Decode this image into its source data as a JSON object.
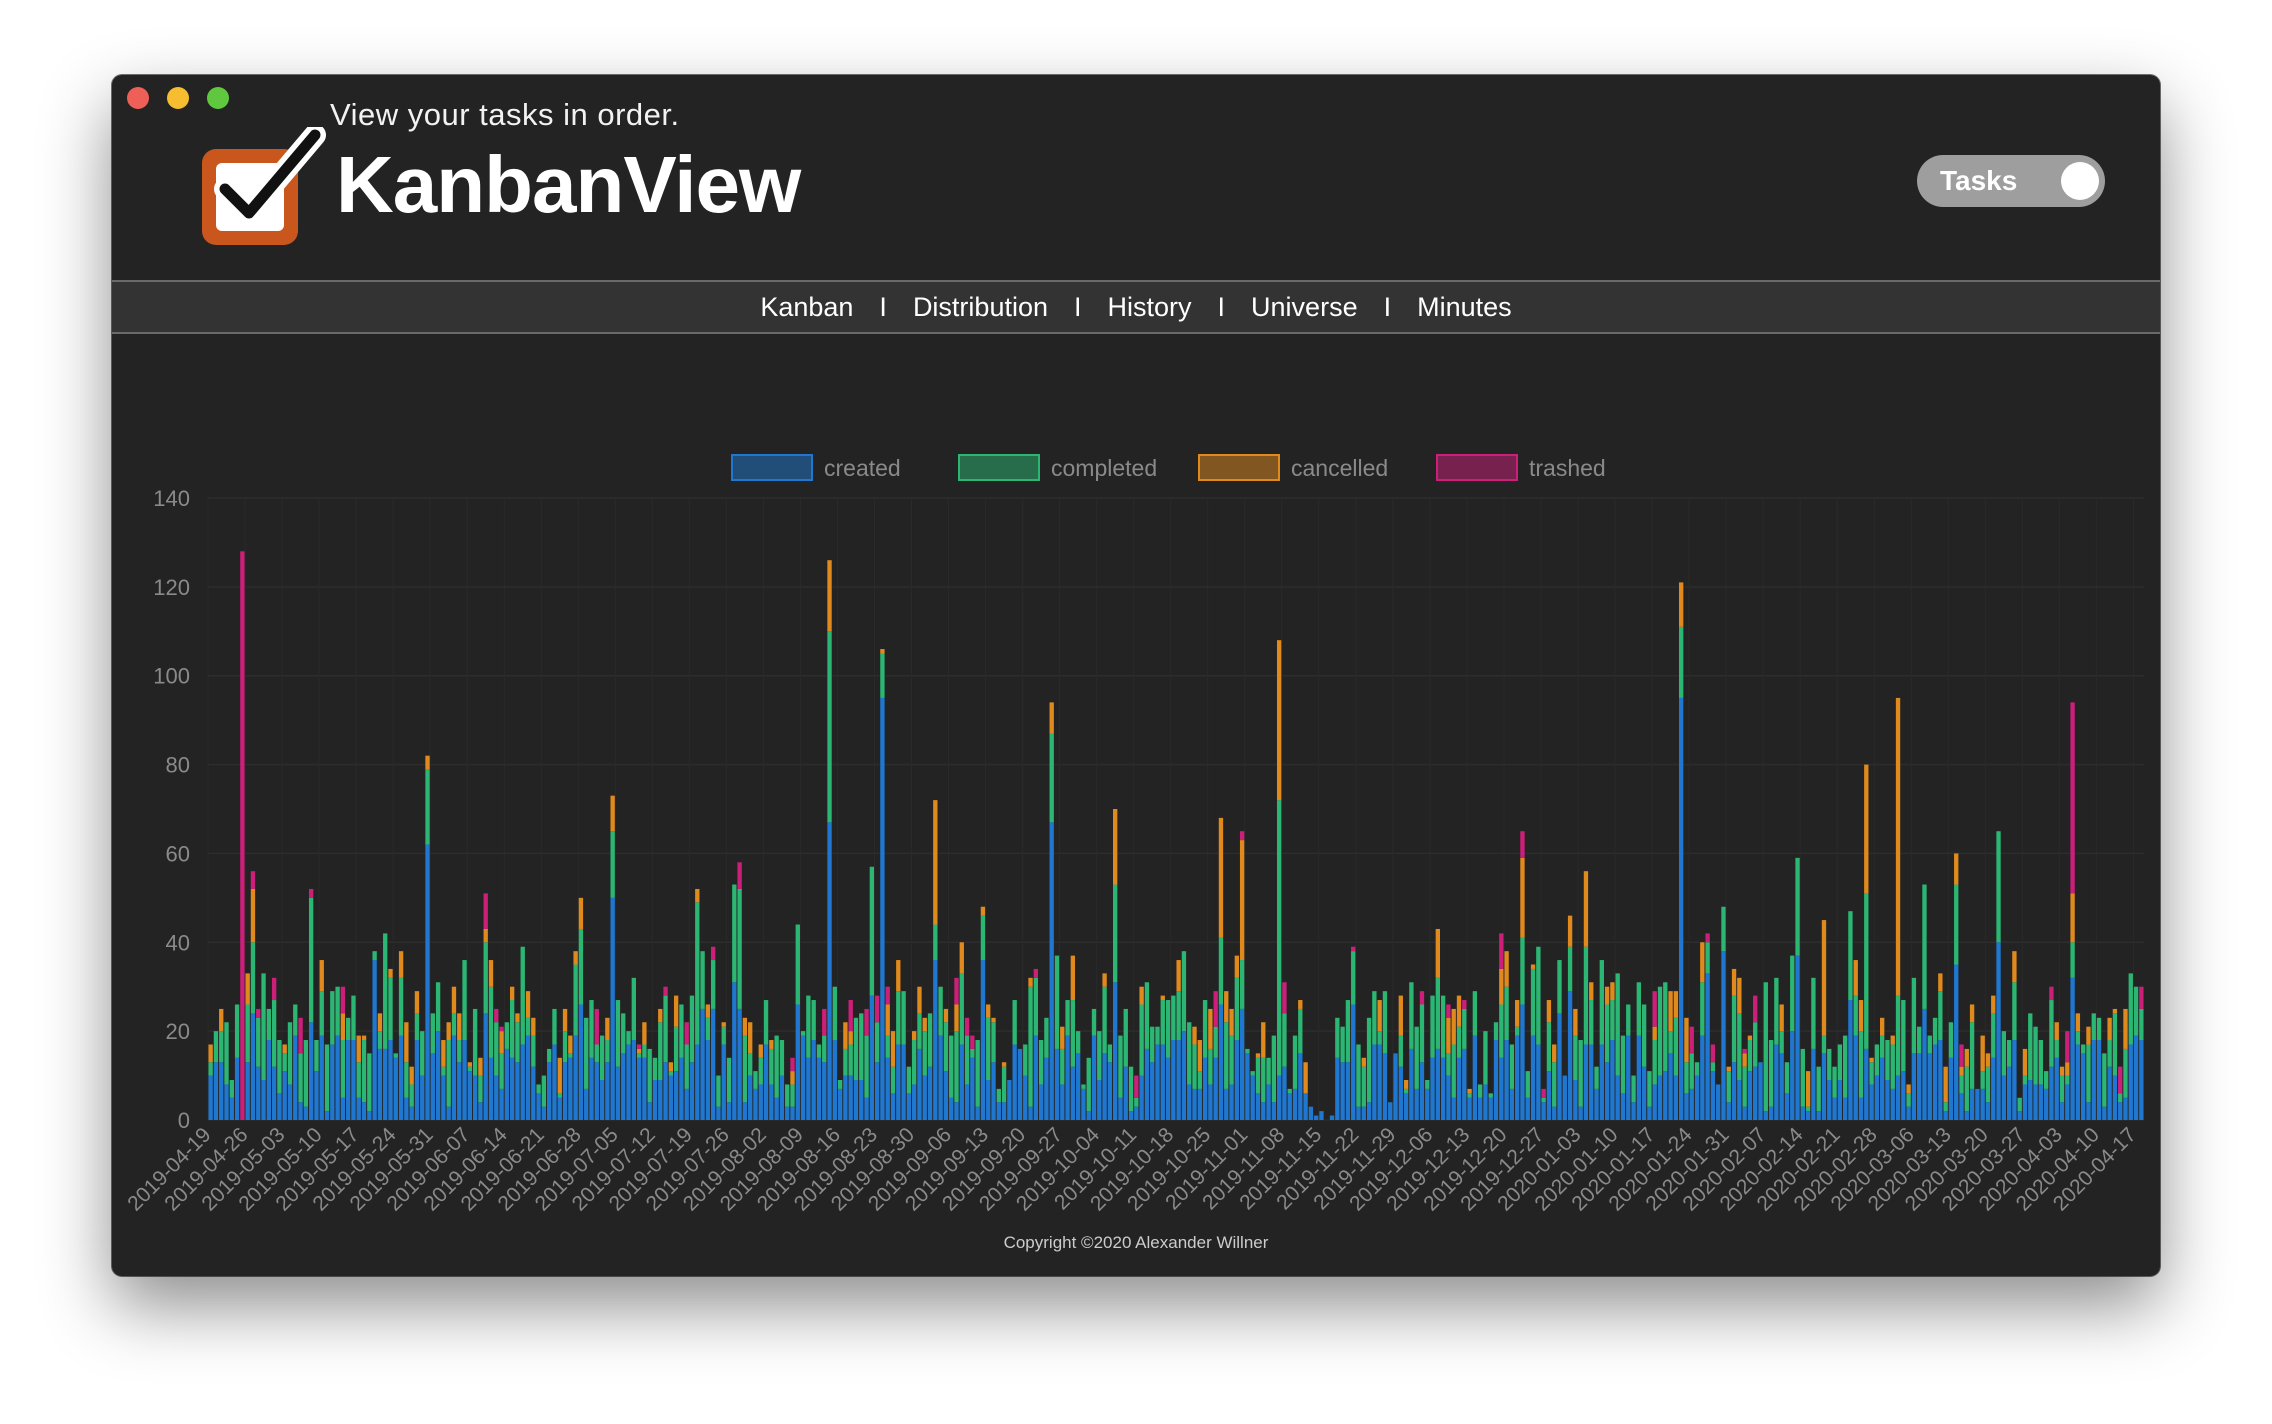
{
  "app": {
    "tagline": "View your tasks in order.",
    "brand": "KanbanView",
    "toggle_label": "Tasks",
    "footer": "Copyright ©2020 Alexander Willner"
  },
  "nav": {
    "items": [
      "Kanban",
      "Distribution",
      "History",
      "Universe",
      "Minutes"
    ],
    "separator": "I"
  },
  "colors": {
    "created": "#1f77d0",
    "completed": "#2bb673",
    "cancelled": "#e08a1e",
    "trashed": "#cc1f7a",
    "background": "#232323"
  },
  "chart_data": {
    "type": "bar",
    "stacked": true,
    "ylim": [
      0,
      140
    ],
    "yticks": [
      0,
      20,
      40,
      60,
      80,
      100,
      120,
      140
    ],
    "grid": true,
    "legend_position": "top-center",
    "legend": [
      "created",
      "completed",
      "cancelled",
      "trashed"
    ],
    "x_start": "2019-04-19",
    "x_end": "2020-04-19",
    "xticks": [
      "2019-04-19",
      "2019-04-26",
      "2019-05-03",
      "2019-05-10",
      "2019-05-17",
      "2019-05-24",
      "2019-05-31",
      "2019-06-07",
      "2019-06-14",
      "2019-06-21",
      "2019-06-28",
      "2019-07-05",
      "2019-07-12",
      "2019-07-19",
      "2019-07-26",
      "2019-08-02",
      "2019-08-09",
      "2019-08-16",
      "2019-08-23",
      "2019-08-30",
      "2019-09-06",
      "2019-09-13",
      "2019-09-20",
      "2019-09-27",
      "2019-10-04",
      "2019-10-11",
      "2019-10-18",
      "2019-10-25",
      "2019-11-01",
      "2019-11-08",
      "2019-11-15",
      "2019-11-22",
      "2019-11-29",
      "2019-12-06",
      "2019-12-13",
      "2019-12-20",
      "2019-12-27",
      "2020-01-03",
      "2020-01-10",
      "2020-01-17",
      "2020-01-24",
      "2020-01-31",
      "2020-02-07",
      "2020-02-14",
      "2020-02-21",
      "2020-02-28",
      "2020-03-06",
      "2020-03-13",
      "2020-03-20",
      "2020-03-27",
      "2020-04-03",
      "2020-04-10",
      "2020-04-17"
    ],
    "peaks": [
      {
        "date": "2019-04-25",
        "trashed": 128
      },
      {
        "date": "2019-08-14",
        "created": 67,
        "completed": 43,
        "cancelled": 16
      },
      {
        "date": "2019-08-24",
        "created": 95,
        "completed": 10,
        "cancelled": 1
      },
      {
        "date": "2019-09-25",
        "created": 67,
        "completed": 20,
        "cancelled": 7
      },
      {
        "date": "2019-11-07",
        "created": 10,
        "completed": 62,
        "cancelled": 36
      },
      {
        "date": "2020-01-22",
        "created": 95,
        "completed": 16,
        "cancelled": 10
      },
      {
        "date": "2020-03-03",
        "created": 10,
        "completed": 18,
        "cancelled": 67
      },
      {
        "date": "2020-04-05",
        "created": 32,
        "completed": 8,
        "cancelled": 11,
        "trashed": 43
      },
      {
        "date": "2019-05-30",
        "created": 62,
        "completed": 17,
        "cancelled": 3
      },
      {
        "date": "2019-07-04",
        "created": 50,
        "completed": 15,
        "cancelled": 8
      }
    ]
  }
}
